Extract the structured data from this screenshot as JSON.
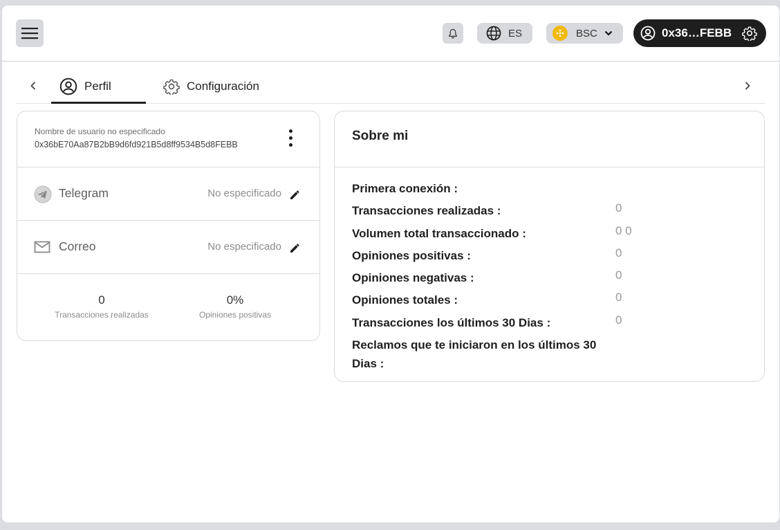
{
  "header": {
    "language": "ES",
    "network": "BSC",
    "wallet_short": "0x36…FEBB"
  },
  "tabs": [
    {
      "label": "Perfil",
      "active": true
    },
    {
      "label": "Configuración",
      "active": false
    }
  ],
  "profile": {
    "username_label": "Nombre de usuario no especificado",
    "address": "0x36bE70Aa87B2bB9d6fd921B5d8ff9534B5d8FEBB",
    "contacts": [
      {
        "name": "Telegram",
        "value": "No especificado",
        "icon": "telegram-icon"
      },
      {
        "name": "Correo",
        "value": "No especificado",
        "icon": "mail-icon"
      }
    ],
    "stats": [
      {
        "value": "0",
        "label": "Transacciones realizadas"
      },
      {
        "value": "0%",
        "label": "Opiniones positivas"
      }
    ]
  },
  "about": {
    "title": "Sobre mi",
    "rows": [
      {
        "label": "Primera conexión :",
        "value": ""
      },
      {
        "label": "Transacciones realizadas :",
        "value": "0"
      },
      {
        "label": "Volumen total transaccionado :",
        "value": "0 0"
      },
      {
        "label": "Opiniones positivas :",
        "value": "0"
      },
      {
        "label": "Opiniones negativas :",
        "value": "0"
      },
      {
        "label": "Opiniones totales :",
        "value": "0"
      },
      {
        "label": "Transacciones los últimos 30 Dias :",
        "value": "0"
      },
      {
        "label": "Reclamos que te iniciaron en los últimos 30 Dias :",
        "value": ""
      }
    ]
  },
  "colors": {
    "wallet_bg": "#1e1e1e",
    "button_bg": "#d8d9dc",
    "bnb": "#f0b90b"
  }
}
